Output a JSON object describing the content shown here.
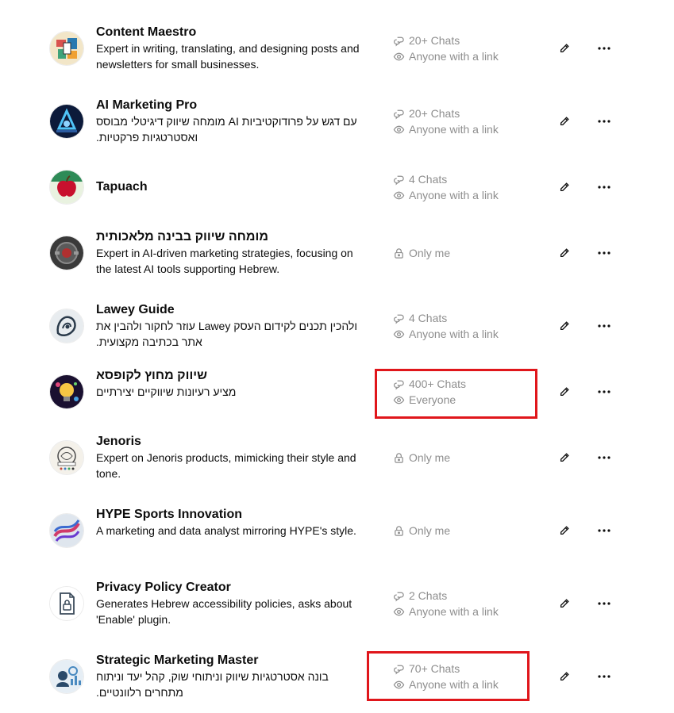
{
  "gpts": [
    {
      "name": "Content Maestro",
      "description": "Expert in writing, translating, and designing posts and newsletters for small businesses.",
      "chats": "20+ Chats",
      "visibility": "Anyone with a link",
      "visibility_icon": "eye-icon"
    },
    {
      "name": "AI Marketing Pro",
      "description": "עם דגש על פרודוקטיביות AI מומחה שיווק דיגיטלי מבוסס ואסטרטגיות פרקטיות.",
      "chats": "20+ Chats",
      "visibility": "Anyone with a link",
      "visibility_icon": "eye-icon"
    },
    {
      "name": "Tapuach",
      "description": "",
      "chats": "4 Chats",
      "visibility": "Anyone with a link",
      "visibility_icon": "eye-icon"
    },
    {
      "name": "מומחה שיווק בבינה מלאכותית",
      "description": "Expert in AI-driven marketing strategies, focusing on the latest AI tools supporting Hebrew.",
      "chats": "",
      "visibility": "Only me",
      "visibility_icon": "lock-icon"
    },
    {
      "name": "Lawey Guide",
      "description": "ולהכין תכנים לקידום העסק Lawey עוזר לחקור ולהבין את אתר בכתיבה מקצועית.",
      "chats": "4 Chats",
      "visibility": "Anyone with a link",
      "visibility_icon": "eye-icon"
    },
    {
      "name": "שיווק מחוץ לקופסא",
      "description": "מציע רעיונות שיווקיים יצירתיים",
      "chats": "400+ Chats",
      "visibility": "Everyone",
      "visibility_icon": "eye-icon"
    },
    {
      "name": "Jenoris",
      "description": "Expert on Jenoris products, mimicking their style and tone.",
      "chats": "",
      "visibility": "Only me",
      "visibility_icon": "lock-icon"
    },
    {
      "name": "HYPE Sports Innovation",
      "description": "A marketing and data analyst mirroring HYPE's style.",
      "chats": "",
      "visibility": "Only me",
      "visibility_icon": "lock-icon"
    },
    {
      "name": "Privacy Policy Creator",
      "description": "Generates Hebrew accessibility policies, asks about 'Enable' plugin.",
      "chats": "2 Chats",
      "visibility": "Anyone with a link",
      "visibility_icon": "eye-icon"
    },
    {
      "name": "Strategic Marketing Master",
      "description": "בונה אסטרטגיות שיווק וניתוחי שוק, קהל יעד וניתוח מתחרים רלוונטיים.",
      "chats": "70+ Chats",
      "visibility": "Anyone with a link",
      "visibility_icon": "eye-icon"
    }
  ],
  "colors": {
    "meta_text": "#8e8e8e",
    "highlight_border": "#e0161b"
  }
}
